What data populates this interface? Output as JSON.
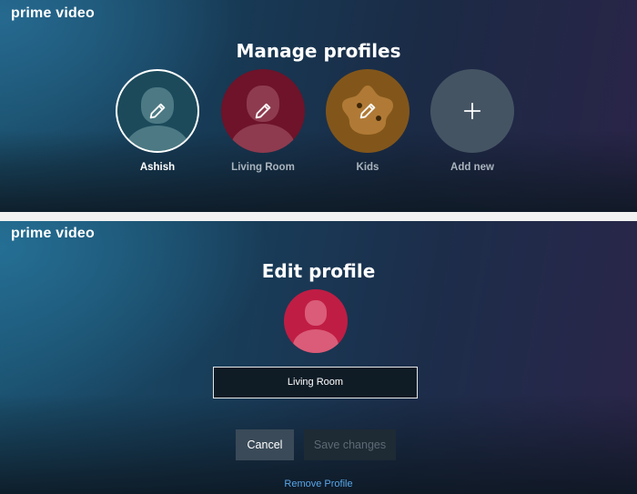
{
  "manage_screen": {
    "logo": "prime video",
    "title": "Manage profiles",
    "profiles": [
      {
        "name": "Ashish",
        "avatar": "adult-avatar-icon",
        "color": "#1e4a5c",
        "selected": true,
        "action_icon": "pencil-icon"
      },
      {
        "name": "Living Room",
        "avatar": "adult-avatar-icon",
        "color": "#7a1530",
        "selected": false,
        "action_icon": "pencil-icon"
      },
      {
        "name": "Kids",
        "avatar": "kids-avatar-icon",
        "color": "#8a5a1a",
        "selected": false,
        "action_icon": "pencil-icon"
      },
      {
        "name": "Add new",
        "avatar": "plus-icon",
        "color": "#4a5866",
        "selected": false,
        "action_icon": "plus-icon"
      }
    ]
  },
  "edit_screen": {
    "logo": "prime video",
    "title": "Edit profile",
    "avatar_color": "#c41f45",
    "name_value": "Living Room",
    "cancel_label": "Cancel",
    "save_label": "Save changes",
    "remove_label": "Remove Profile"
  },
  "colors": {
    "accent_link": "#58a6e8",
    "button_cancel": "#3a4a58",
    "button_save_disabled": "#1e2a34"
  }
}
